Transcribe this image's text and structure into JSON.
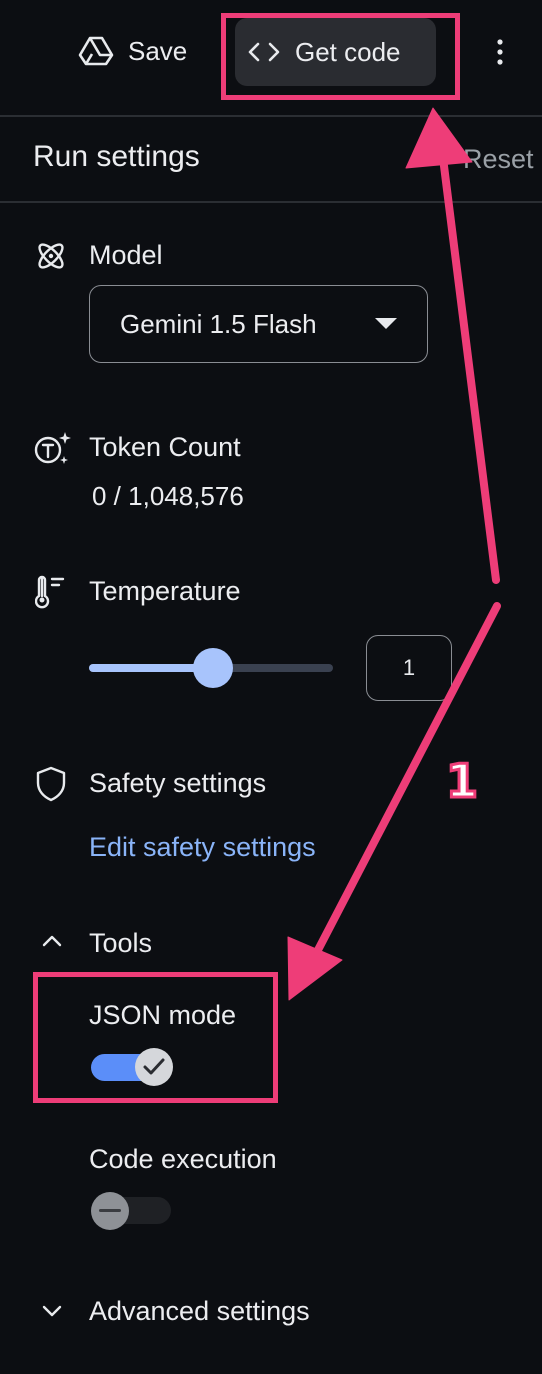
{
  "topbar": {
    "save_label": "Save",
    "get_code_label": "Get code"
  },
  "run_settings": {
    "title": "Run settings",
    "reset_label": "Reset"
  },
  "model": {
    "label": "Model",
    "selected": "Gemini 1.5 Flash"
  },
  "token_count": {
    "label": "Token Count",
    "value": "0 / 1,048,576"
  },
  "temperature": {
    "label": "Temperature",
    "value": "1",
    "slider_fraction": 0.5
  },
  "safety": {
    "label": "Safety settings",
    "link": "Edit safety settings"
  },
  "tools": {
    "label": "Tools",
    "json_mode": {
      "label": "JSON mode",
      "enabled": true
    },
    "code_execution": {
      "label": "Code execution",
      "enabled": false
    }
  },
  "advanced": {
    "label": "Advanced settings"
  },
  "annotation": {
    "step": "1"
  },
  "colors": {
    "accent": "#5b8ef9",
    "link": "#8ab4f8",
    "highlight": "#ee3d78",
    "background": "#0c0e12"
  }
}
